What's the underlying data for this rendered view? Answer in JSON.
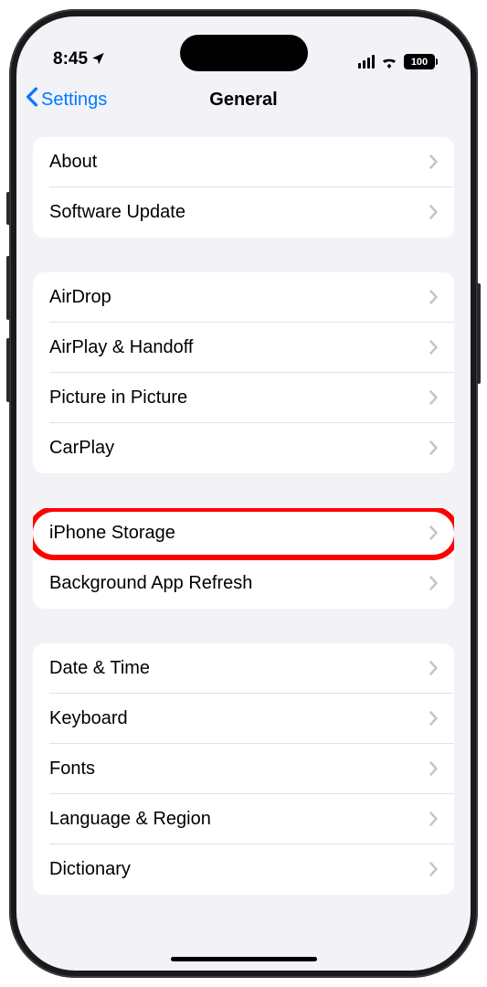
{
  "status": {
    "time": "8:45",
    "battery": "100"
  },
  "nav": {
    "back": "Settings",
    "title": "General"
  },
  "groups": [
    {
      "rows": [
        {
          "key": "about",
          "label": "About"
        },
        {
          "key": "software-update",
          "label": "Software Update"
        }
      ]
    },
    {
      "rows": [
        {
          "key": "airdrop",
          "label": "AirDrop"
        },
        {
          "key": "airplay-handoff",
          "label": "AirPlay & Handoff"
        },
        {
          "key": "picture-in-picture",
          "label": "Picture in Picture"
        },
        {
          "key": "carplay",
          "label": "CarPlay"
        }
      ]
    },
    {
      "rows": [
        {
          "key": "iphone-storage",
          "label": "iPhone Storage",
          "highlighted": true
        },
        {
          "key": "background-app-refresh",
          "label": "Background App Refresh"
        }
      ]
    },
    {
      "rows": [
        {
          "key": "date-time",
          "label": "Date & Time"
        },
        {
          "key": "keyboard",
          "label": "Keyboard"
        },
        {
          "key": "fonts",
          "label": "Fonts"
        },
        {
          "key": "language-region",
          "label": "Language & Region"
        },
        {
          "key": "dictionary",
          "label": "Dictionary"
        }
      ]
    }
  ]
}
